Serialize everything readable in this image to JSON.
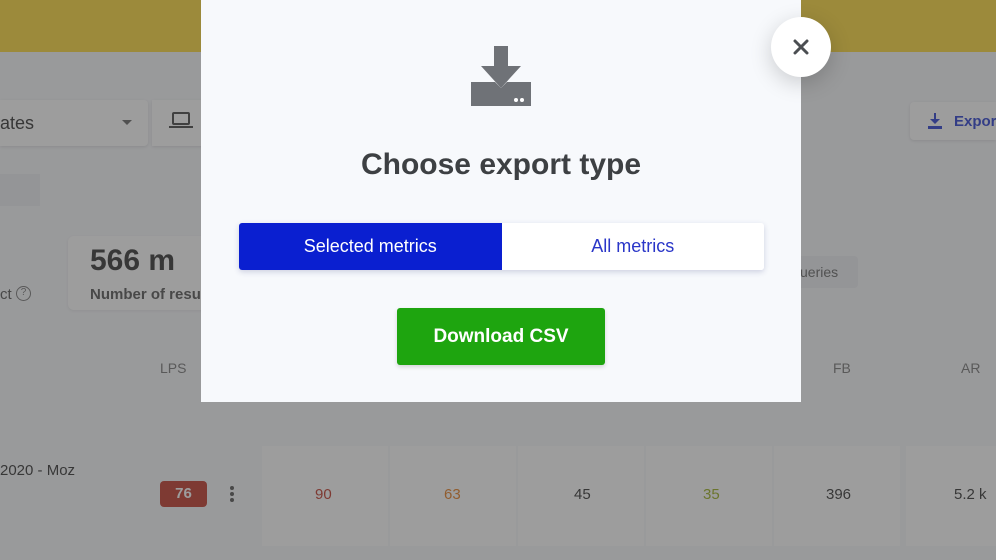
{
  "background": {
    "dropdown_text": "ates",
    "stat_value": "566 m",
    "stat_label": "Number of resu",
    "left_label": "ct",
    "help_symbol": "?",
    "export_label": "Export",
    "queries_label": "ueries",
    "columns": {
      "lps": "LPS",
      "fb": "FB",
      "ar": "AR"
    },
    "row": {
      "label": "2020 - Moz",
      "lps_badge": "76",
      "values": [
        {
          "text": "90",
          "color": "#c0392b"
        },
        {
          "text": "63",
          "color": "#e67e22"
        },
        {
          "text": "45",
          "color": "#333333"
        },
        {
          "text": "35",
          "color": "#9aae1e"
        },
        {
          "text": "396",
          "color": "#333333"
        },
        {
          "text": "5.2 k",
          "color": "#333333"
        }
      ]
    }
  },
  "modal": {
    "icon": "download-tray-icon",
    "title": "Choose export type",
    "options": {
      "selected": "Selected metrics",
      "all": "All metrics"
    },
    "download_label": "Download CSV",
    "close_icon": "close-icon"
  },
  "colors": {
    "topbar": "#fcd83a",
    "primary_blue": "#0a1fd0",
    "download_green": "#1ea50f"
  }
}
